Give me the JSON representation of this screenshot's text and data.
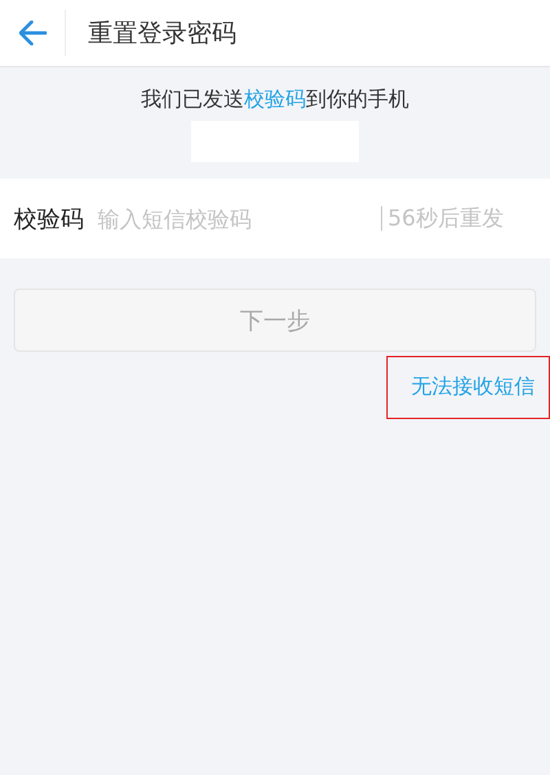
{
  "header": {
    "title": "重置登录密码"
  },
  "message": {
    "before": "我们已发送",
    "highlight": "校验码",
    "after": "到你的手机"
  },
  "code_field": {
    "label": "校验码",
    "placeholder": "输入短信校验码",
    "resend": "56秒后重发"
  },
  "next_button": {
    "label": "下一步",
    "disabled": true
  },
  "help_link": {
    "label": "无法接收短信",
    "highlighted": true
  }
}
